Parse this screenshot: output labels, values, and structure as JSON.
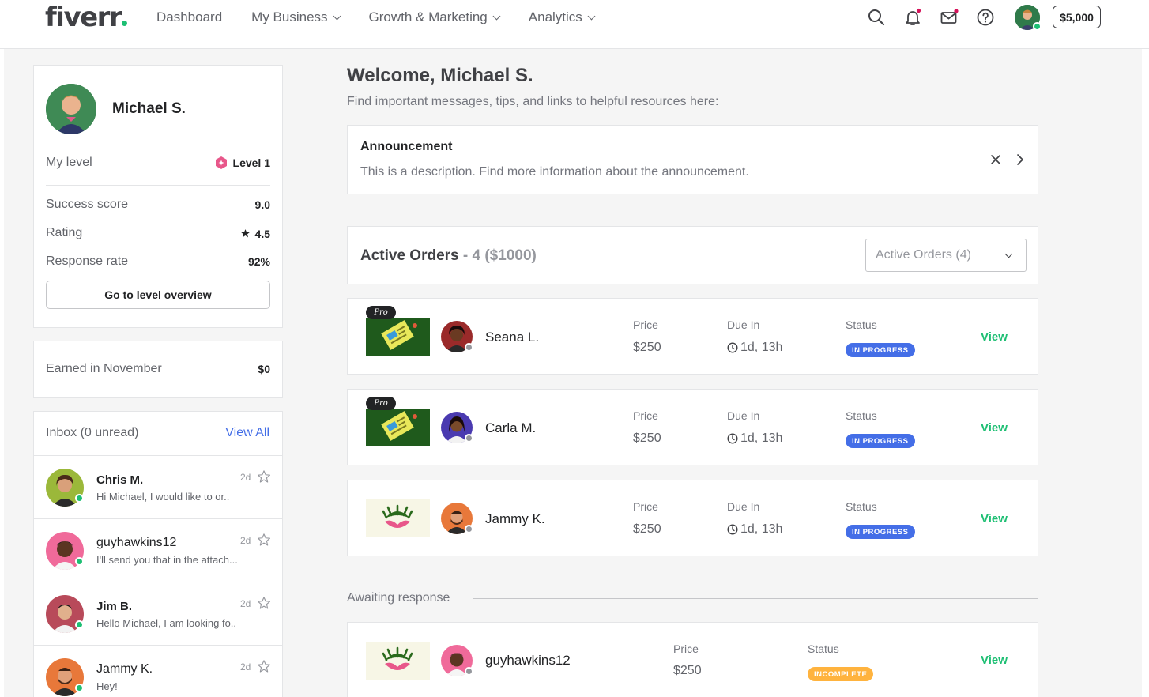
{
  "header": {
    "logo": "fiverr",
    "nav": [
      {
        "label": "Dashboard",
        "dropdown": false
      },
      {
        "label": "My Business",
        "dropdown": true
      },
      {
        "label": "Growth & Marketing",
        "dropdown": true
      },
      {
        "label": "Analytics",
        "dropdown": true
      }
    ],
    "balance": "$5,000",
    "icons": [
      "search-icon",
      "bell-icon",
      "mail-icon",
      "help-icon"
    ]
  },
  "profile": {
    "name": "Michael S.",
    "level_label": "My level",
    "level_value": "Level 1",
    "stats": [
      {
        "label": "Success score",
        "value": "9.0"
      },
      {
        "label": "Rating",
        "value": "4.5"
      },
      {
        "label": "Response rate",
        "value": "92%"
      }
    ],
    "level_button": "Go to level overview"
  },
  "earnings": {
    "label": "Earned in November",
    "value": "$0"
  },
  "inbox": {
    "title": "Inbox (0 unread)",
    "view_all": "View All",
    "items": [
      {
        "name": "Chris M.",
        "message": "Hi Michael, I would like to or..",
        "time": "2d"
      },
      {
        "name": "guyhawkins12",
        "message": "I'll send you that in the attach...",
        "time": "2d"
      },
      {
        "name": "Jim B.",
        "message": "Hello Michael, I am looking fo..",
        "time": "2d"
      },
      {
        "name": "Jammy K.",
        "message": "Hey!",
        "time": "2d"
      }
    ]
  },
  "welcome": {
    "title": "Welcome, Michael S.",
    "subtitle": "Find important messages, tips, and links to helpful resources here:"
  },
  "announcement": {
    "title": "Announcement",
    "description": "This is a description. Find more information about the announcement."
  },
  "active_orders": {
    "title": "Active Orders",
    "count": "- 4 ($1000)",
    "select_value": "Active Orders (4)",
    "price_label": "Price",
    "due_label": "Due In",
    "status_label": "Status",
    "pro_label": "Pro",
    "view_label": "View",
    "orders": [
      {
        "name": "Seana L.",
        "price": "$250",
        "due": "1d, 13h",
        "status": "IN PROGRESS"
      },
      {
        "name": "Carla M.",
        "price": "$250",
        "due": "1d, 13h",
        "status": "IN PROGRESS"
      },
      {
        "name": "Jammy K.",
        "price": "$250",
        "due": "1d, 13h",
        "status": "IN PROGRESS"
      }
    ]
  },
  "awaiting": {
    "title": "Awaiting response",
    "order": {
      "name": "guyhawkins12",
      "price_label": "Price",
      "price": "$250",
      "status_label": "Status",
      "status": "INCOMPLETE",
      "view_label": "View"
    }
  },
  "colors": {
    "brand_green": "#1dbf73",
    "in_progress": "#446ee7",
    "incomplete": "#ffb33e",
    "notification_dot": "#d5135a"
  }
}
